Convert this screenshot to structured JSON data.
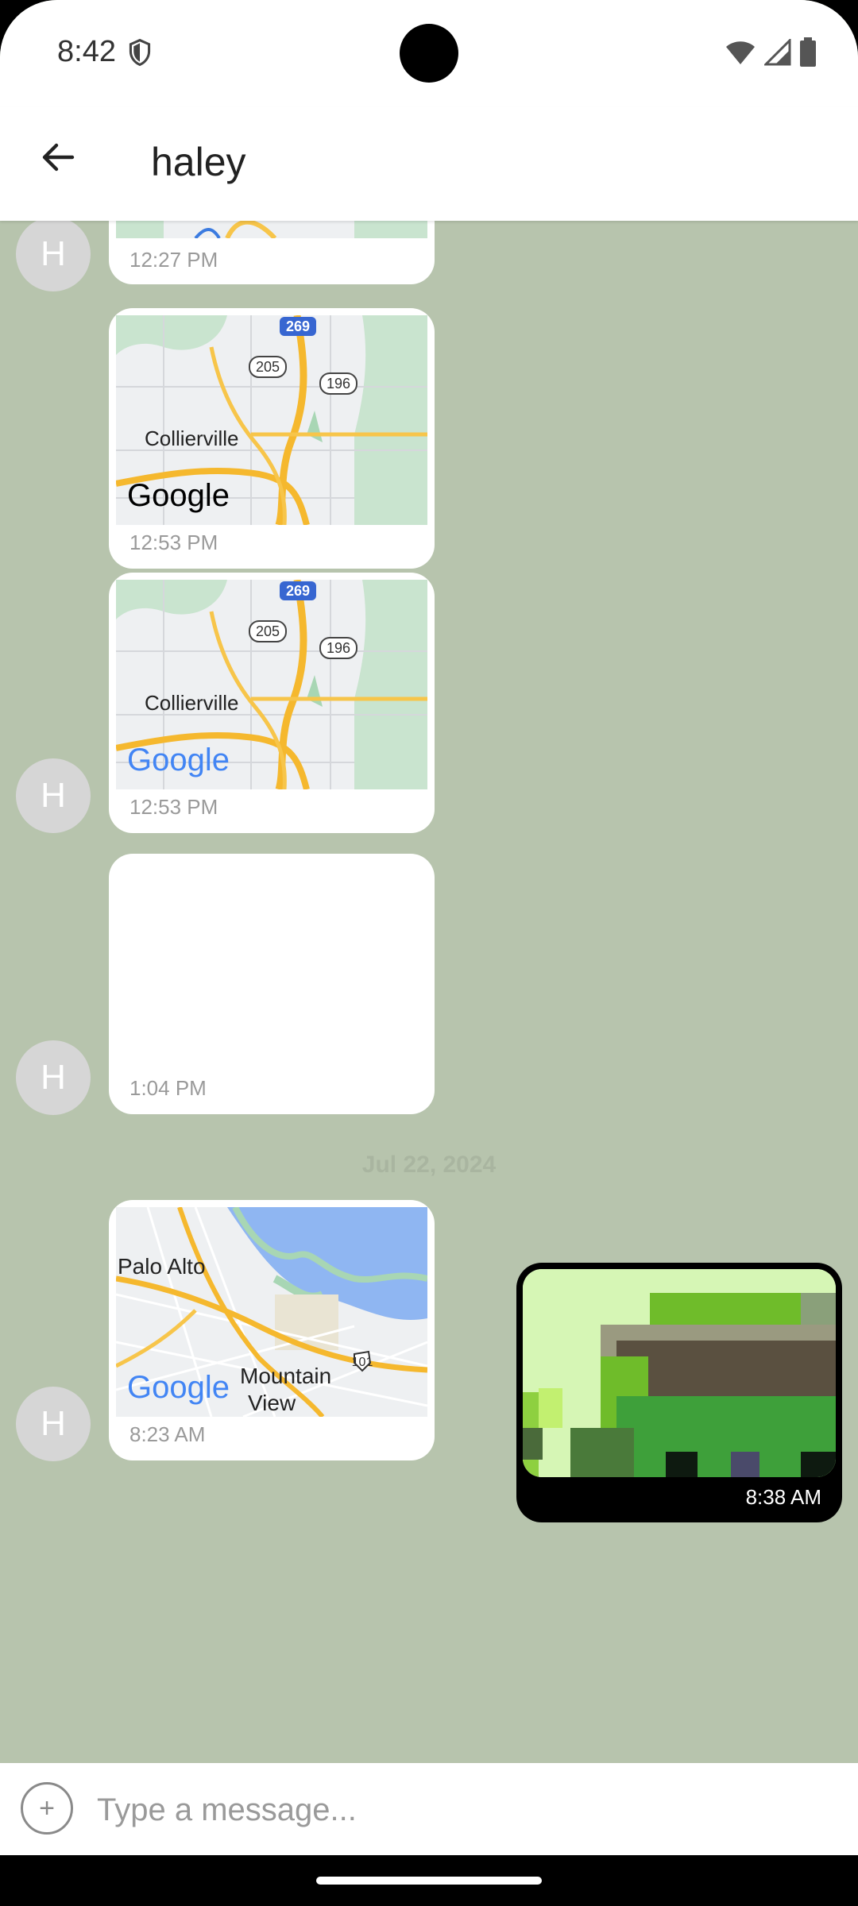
{
  "status_bar": {
    "time": "8:42"
  },
  "app_bar": {
    "title": "haley",
    "back_icon": "arrow-left-icon"
  },
  "messages": [
    {
      "type": "map",
      "avatar": "H",
      "time": "12:27 PM"
    },
    {
      "type": "map",
      "time": "12:53 PM",
      "map_label": "Collierville",
      "shields": [
        "269",
        "205",
        "196"
      ]
    },
    {
      "type": "map",
      "avatar": "H",
      "time": "12:53 PM",
      "map_label": "Collierville",
      "shields": [
        "269",
        "205",
        "196"
      ]
    },
    {
      "type": "blank",
      "avatar": "H",
      "time": "1:04 PM"
    },
    {
      "type": "map",
      "avatar": "H",
      "time": "8:23 AM",
      "map_labels": [
        "Palo Alto",
        "Mountain",
        "View"
      ],
      "shields": [
        "101"
      ]
    },
    {
      "type": "image",
      "sent": true,
      "time": "8:38 AM"
    }
  ],
  "date_separator": "Jul 22, 2024",
  "map_brand": "Google",
  "composer": {
    "placeholder": "Type a message...",
    "plus_icon": "plus-icon"
  },
  "colors": {
    "chat_background": "#b7c4ad",
    "bubble": "#ffffff",
    "sent_bubble": "#000000"
  }
}
